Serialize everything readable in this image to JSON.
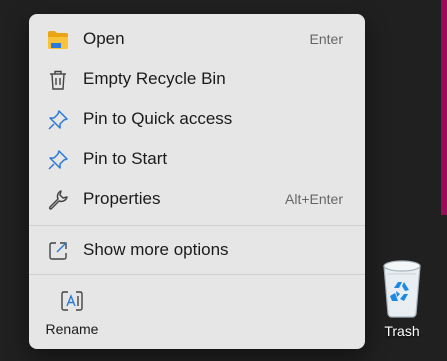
{
  "menu": {
    "items": [
      {
        "label": "Open",
        "shortcut": "Enter",
        "icon": "folder-icon"
      },
      {
        "label": "Empty Recycle Bin",
        "shortcut": "",
        "icon": "trash-can-icon"
      },
      {
        "label": "Pin to Quick access",
        "shortcut": "",
        "icon": "pin-icon"
      },
      {
        "label": "Pin to Start",
        "shortcut": "",
        "icon": "pin-icon"
      },
      {
        "label": "Properties",
        "shortcut": "Alt+Enter",
        "icon": "wrench-icon"
      },
      {
        "label": "Show more options",
        "shortcut": "",
        "icon": "open-external-icon"
      }
    ],
    "rename": {
      "label": "Rename",
      "icon": "rename-icon"
    }
  },
  "desktop": {
    "icon_label": "Trash",
    "icon": "recycle-bin-icon"
  },
  "colors": {
    "menu_background": "#e6e6e6",
    "desktop_background": "#202020",
    "accent_strip": "#9c0a5e",
    "pin_blue": "#2b79d8",
    "folder_yellow": "#f8c33a"
  }
}
